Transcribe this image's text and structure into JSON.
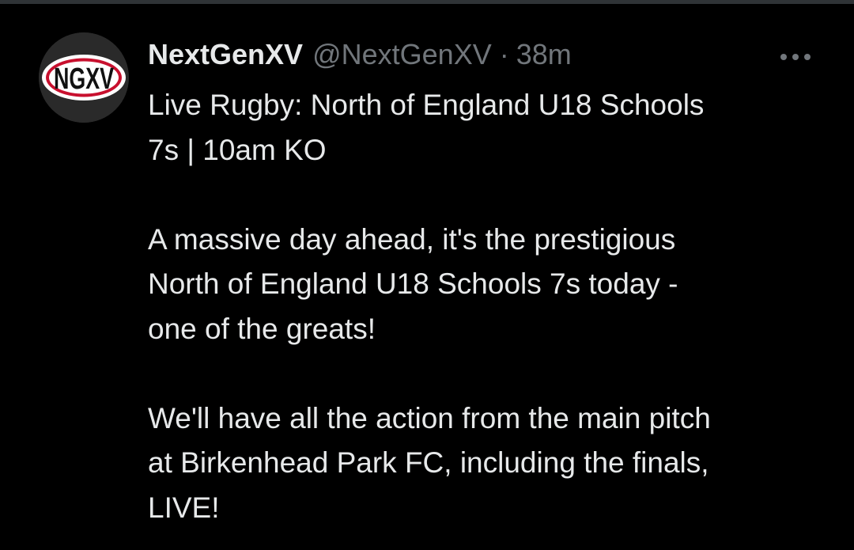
{
  "tweet": {
    "author": {
      "display_name": "NextGenXV",
      "handle": "@NextGenXV",
      "avatar_text": "NGXV"
    },
    "separator": "·",
    "time": "38m",
    "more_icon": "more-horizontal-icon",
    "text": "Live Rugby: North of England U18 Schools\n7s | 10am KO\n\nA massive day ahead, it's the prestigious\nNorth of England U18 Schools 7s today -\none of the greats!\n\nWe'll have all the action from the main pitch\nat Birkenhead Park FC, including the finals,\nLIVE!"
  },
  "colors": {
    "background": "#000000",
    "text_primary": "#e7e9ea",
    "text_secondary": "#71767b",
    "logo_red": "#c8102e",
    "divider": "#2f3336"
  }
}
